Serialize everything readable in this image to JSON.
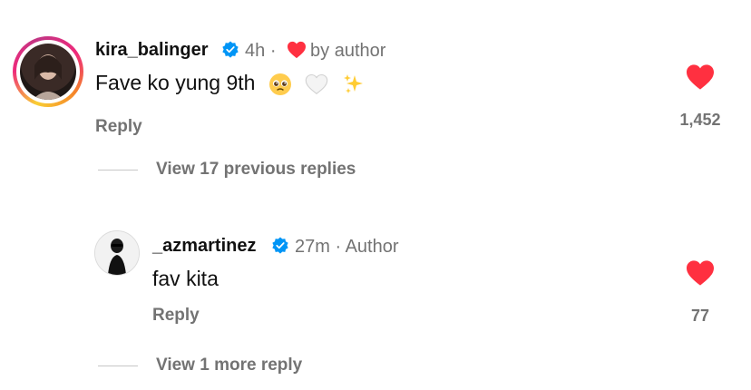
{
  "comments": [
    {
      "username": "kira_balinger",
      "time": "4h",
      "separator": "·",
      "badge_text": "by author",
      "text": "Fave ko yung 9th",
      "emojis": [
        "pleading-face-emoji",
        "white-heart-emoji",
        "sparkles-emoji"
      ],
      "reply_label": "Reply",
      "like_count": "1,452",
      "view_replies": "View 17 previous replies"
    },
    {
      "username": "_azmartinez",
      "time": "27m",
      "separator": "·",
      "badge_text": "Author",
      "text": "fav kita",
      "reply_label": "Reply",
      "like_count": "77",
      "view_replies": "View 1 more reply"
    }
  ],
  "colors": {
    "heart": "#ff3040",
    "verified": "#0095f6",
    "secondary_text": "#737373"
  }
}
